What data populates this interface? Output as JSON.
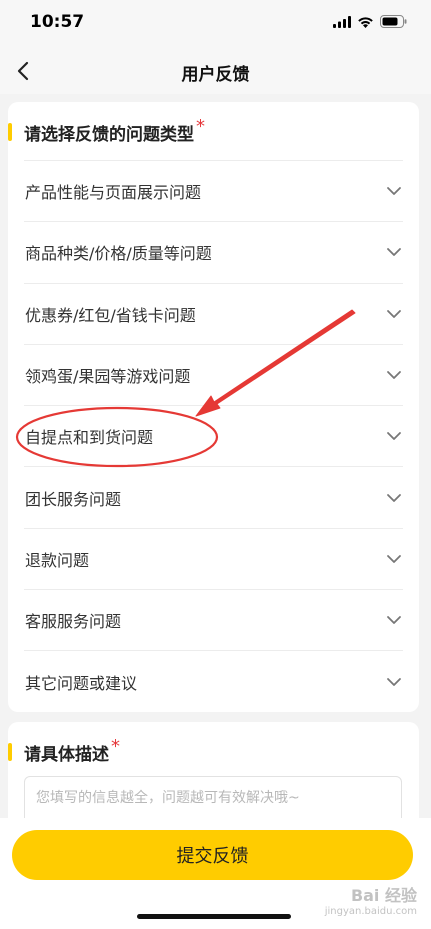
{
  "status_bar": {
    "time": "10:57"
  },
  "nav": {
    "title": "用户反馈"
  },
  "types_section": {
    "title": "请选择反馈的问题类型",
    "required_mark": "*",
    "items": [
      {
        "label": "产品性能与页面展示问题"
      },
      {
        "label": "商品种类/价格/质量等问题"
      },
      {
        "label": "优惠券/红包/省钱卡问题"
      },
      {
        "label": "领鸡蛋/果园等游戏问题"
      },
      {
        "label": "自提点和到货问题"
      },
      {
        "label": "团长服务问题"
      },
      {
        "label": "退款问题"
      },
      {
        "label": "客服服务问题"
      },
      {
        "label": "其它问题或建议"
      }
    ]
  },
  "desc_section": {
    "title": "请具体描述",
    "required_mark": "*",
    "placeholder": "您填写的信息越全，问题越可有效解决哦~"
  },
  "submit": {
    "label": "提交反馈"
  },
  "watermark": {
    "text": "Bai 经验",
    "sub": "jingyan.baidu.com"
  },
  "colors": {
    "accent": "#ffcc00",
    "required": "#e5383b",
    "annotation": "#e53935"
  }
}
